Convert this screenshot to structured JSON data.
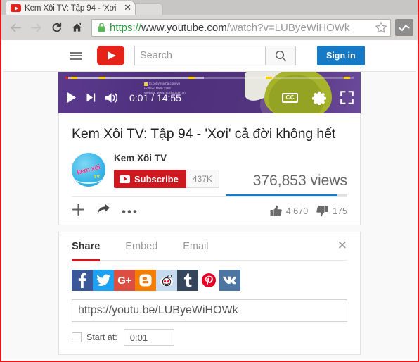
{
  "browser": {
    "tab": {
      "title": "Kem Xôi TV: Tập 94 - 'Xơi",
      "favicon": "youtube-icon",
      "close": "✕"
    },
    "nav": {
      "back": "back-arrow-icon",
      "forward": "forward-arrow-icon",
      "reload": "reload-icon",
      "home": "home-icon"
    },
    "omnibox": {
      "lock": "lock-icon",
      "scheme": "https://",
      "host": "www.youtube.com",
      "path": "/watch?v=LUByeWiHOWk",
      "full_url": "https://www.youtube.com/watch?v=LUByeWiHOWk",
      "bookmark": "star-icon",
      "extension": "checkmark-icon"
    }
  },
  "masthead": {
    "guide": "hamburger-menu-icon",
    "logo": "youtube-logo",
    "search_placeholder": "Search",
    "search_button": "search-icon",
    "signin_label": "Sign in"
  },
  "player": {
    "play": "play-icon",
    "next": "next-track-icon",
    "volume": "volume-icon",
    "time": "0:01 / 14:55",
    "current_time": "0:01",
    "duration": "14:55",
    "cc_label": "CC",
    "settings": "gear-icon",
    "fullscreen": "fullscreen-icon",
    "watermark_line1": "fb.com/mocha.com.vn",
    "watermark_line2": "Hotline: 1900 1255",
    "watermark_line3": "Website: www.mocha.com.vn",
    "progress_played_pct": 1,
    "progress_loaded_pct": 48
  },
  "video": {
    "title": "Kem Xôi TV: Tập 94 - 'Xơi' cả đời không hết",
    "channel_name": "Kem Xôi TV",
    "avatar_text": "kem xôi",
    "avatar_tv": "TV",
    "subscribe_label": "Subscribe",
    "subscriber_count": "437K",
    "view_count": "376,853 views",
    "likes": "4,670",
    "dislikes": "175",
    "add_to_icon": "plus-icon",
    "share_icon": "share-arrow-icon",
    "more_icon": "more-horizontal-icon",
    "like_icon": "thumbs-up-icon",
    "dislike_icon": "thumbs-down-icon"
  },
  "share_panel": {
    "tabs": [
      {
        "label": "Share",
        "active": true
      },
      {
        "label": "Embed",
        "active": false
      },
      {
        "label": "Email",
        "active": false
      }
    ],
    "close": "✕",
    "socials": [
      {
        "name": "facebook",
        "glyph": "f",
        "color": "#3b5998"
      },
      {
        "name": "twitter",
        "glyph": "",
        "color": "#1da1f2"
      },
      {
        "name": "googleplus",
        "glyph": "G+",
        "color": "#dc4e41"
      },
      {
        "name": "blogger",
        "glyph": "B",
        "color": "#f57d00"
      },
      {
        "name": "reddit",
        "glyph": "",
        "color": "#c6dbf0"
      },
      {
        "name": "tumblr",
        "glyph": "t",
        "color": "#35465c"
      },
      {
        "name": "pinterest",
        "glyph": "P",
        "color": "#ffffff"
      },
      {
        "name": "vk",
        "glyph": "VK",
        "color": "#4c75a3"
      }
    ],
    "link_value": "https://youtu.be/LUByeWiHOWk",
    "start_at_label": "Start at:",
    "start_at_value": "0:01",
    "start_at_checked": false
  },
  "colors": {
    "youtube_red": "#e62117",
    "subscribe_red": "#cc181e",
    "signin_blue": "#167ac6",
    "view_bar_blue": "#167ac6",
    "frame_red": "#e01b1b"
  }
}
